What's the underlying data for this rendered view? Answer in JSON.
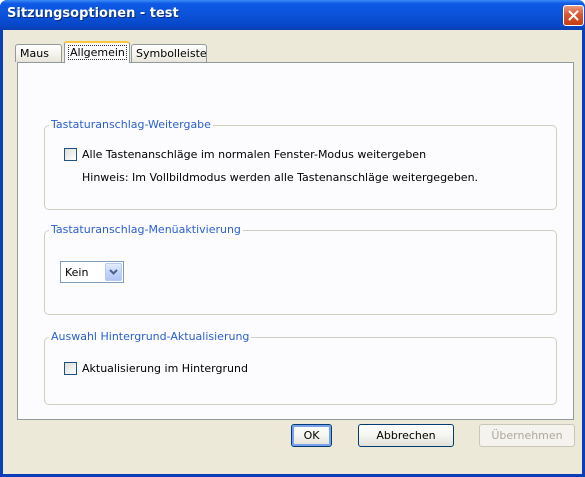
{
  "window": {
    "title": "Sitzungsoptionen - test"
  },
  "tabs": [
    {
      "label": "Maus",
      "active": false
    },
    {
      "label": "Allgemein",
      "active": true
    },
    {
      "label": "Symbolleiste",
      "active": false
    }
  ],
  "groups": {
    "keystroke_forwarding": {
      "legend": "Tastaturanschlag-Weitergabe",
      "checkbox_label": "Alle Tastenanschläge im normalen Fenster-Modus weitergeben",
      "checked": false,
      "hint": "Hinweis: Im Vollbildmodus werden alle Tastenanschläge weitergegeben."
    },
    "menu_activation": {
      "legend": "Tastaturanschlag-Menüaktivierung",
      "select_value": "Kein"
    },
    "background_update": {
      "legend": "Auswahl Hintergrund-Aktualisierung",
      "checkbox_label": "Aktualisierung im Hintergrund",
      "checked": false
    }
  },
  "buttons": {
    "ok": "OK",
    "cancel": "Abbrechen",
    "apply": "Übernehmen"
  },
  "colors": {
    "titlebar": "#0a52d8",
    "dialog_bg": "#ece9d8",
    "group_legend": "#2a5fd0",
    "active_tab_highlight": "#ffc83c"
  }
}
